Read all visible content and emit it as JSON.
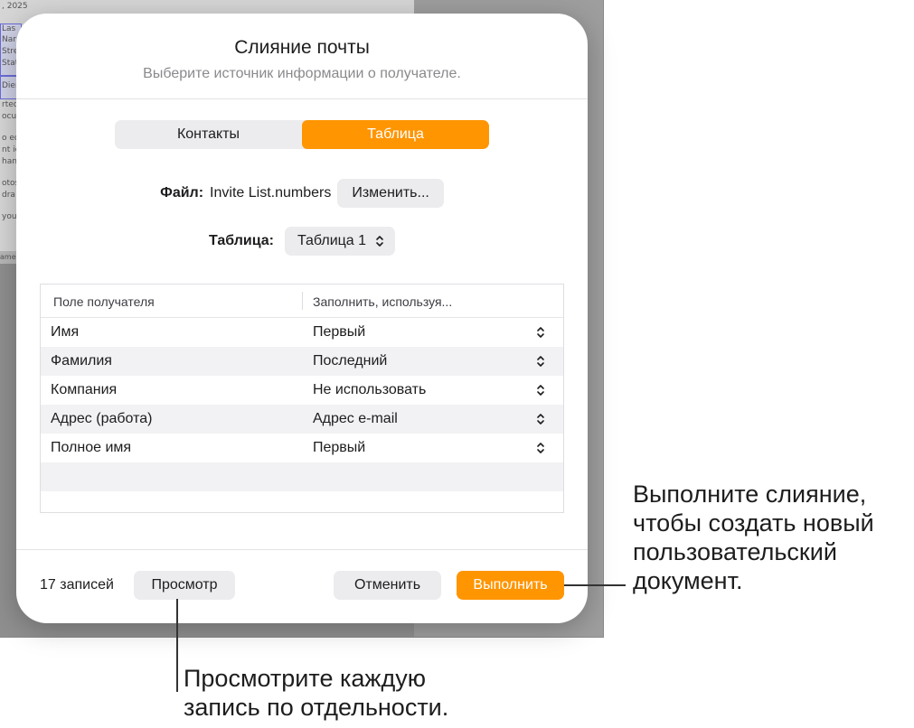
{
  "background": {
    "date_fragment": ", 2025",
    "text_lines": [
      "Las",
      "Nar",
      "Stre",
      "Stat",
      "Dier",
      "rted",
      "ocu",
      "o ed",
      "nt ic",
      "hanc",
      "otos",
      "dra",
      "you",
      "ame"
    ]
  },
  "dialog": {
    "title": "Слияние почты",
    "subtitle": "Выберите источник информации о получателе.",
    "tabs": [
      {
        "label": "Контакты",
        "active": false
      },
      {
        "label": "Таблица",
        "active": true
      }
    ],
    "file_label": "Файл:",
    "file_name": "Invite List.numbers",
    "change_button": "Изменить...",
    "table_label": "Таблица:",
    "table_value": "Таблица 1",
    "grid": {
      "headers": [
        "Поле получателя",
        "Заполнить, используя..."
      ],
      "rows": [
        {
          "field": "Имя",
          "fill": "Первый"
        },
        {
          "field": "Фамилия",
          "fill": "Последний"
        },
        {
          "field": "Компания",
          "fill": "Не использовать"
        },
        {
          "field": "Адрес (работа)",
          "fill": "Адрес e-mail"
        },
        {
          "field": "Полное имя",
          "fill": "Первый"
        }
      ]
    },
    "records_count": "17 записей",
    "preview_button": "Просмотр",
    "cancel_button": "Отменить",
    "run_button": "Выполнить",
    "accent_color": "#ff9500"
  },
  "callouts": {
    "run": [
      "Выполните слияние,",
      "чтобы создать новый",
      "пользовательский",
      "документ."
    ],
    "preview": [
      "Просмотрите каждую",
      "запись по отдельности."
    ]
  }
}
